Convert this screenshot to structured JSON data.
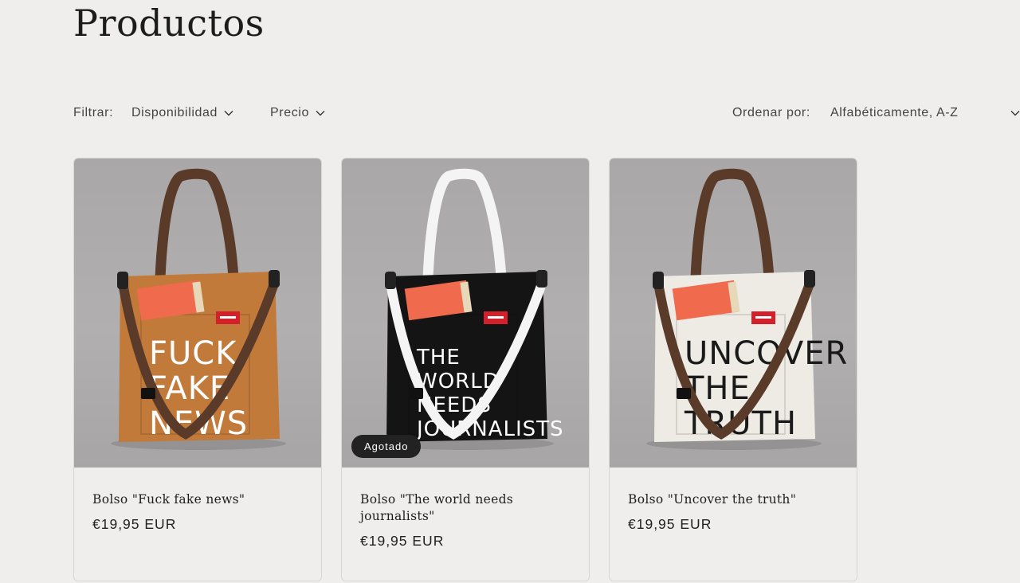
{
  "page": {
    "title": "Productos"
  },
  "filters": {
    "label": "Filtrar:",
    "availability": "Disponibilidad",
    "price": "Precio"
  },
  "sort": {
    "label": "Ordenar por:",
    "selected": "Alfabéticamente, A-Z"
  },
  "products": [
    {
      "name": "Bolso \"Fuck fake news\"",
      "price": "€19,95 EUR",
      "bag_color": "#c17a3a",
      "strap_color": "#5a3a28",
      "print_color": "#ffffff",
      "print_text": [
        "FUCK",
        "FAKE",
        "NEWS"
      ]
    },
    {
      "name": "Bolso \"The world needs journalists\"",
      "price": "€19,95 EUR",
      "badge": "Agotado",
      "bag_color": "#141414",
      "strap_color": "#f4f4f4",
      "print_color": "#ffffff",
      "print_text": [
        "THE",
        "WORLD",
        "NEEDS",
        "JOURNALISTS"
      ]
    },
    {
      "name": "Bolso \"Uncover the truth\"",
      "price": "€19,95 EUR",
      "bag_color": "#eeeae4",
      "strap_color": "#5a3a28",
      "print_color": "#1a1a1a",
      "print_text": [
        "UNCOVER",
        "THE",
        "TRUTH"
      ]
    }
  ],
  "colors": {
    "background": "#efeeec",
    "badge_bg": "#222222",
    "text": "#222222",
    "book_cover": "#f06a4e",
    "label_tag": "#d4202a"
  }
}
